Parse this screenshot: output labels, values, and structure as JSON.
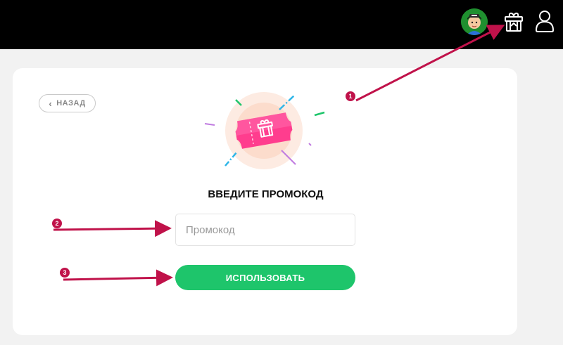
{
  "header": {
    "avatar_icon": "user-avatar-icon",
    "gift_icon": "gift-icon",
    "profile_icon": "user-profile-icon"
  },
  "card": {
    "back_label": "НАЗАД",
    "back_icon": "chevron-left-icon",
    "illustration_icon": "gift-ticket-icon",
    "title": "ВВЕДИТЕ ПРОМОКОД",
    "promo_input": {
      "value": "",
      "placeholder": "Промокод"
    },
    "use_button_label": "ИСПОЛЬЗОВАТЬ"
  },
  "annotations": {
    "markers": [
      "1",
      "2",
      "3"
    ],
    "color": "#c0124a"
  },
  "colors": {
    "topbar": "#000000",
    "page_bg": "#f2f2f2",
    "accent_green": "#1ec56b",
    "ticket_pink": "#ff3d8e"
  }
}
